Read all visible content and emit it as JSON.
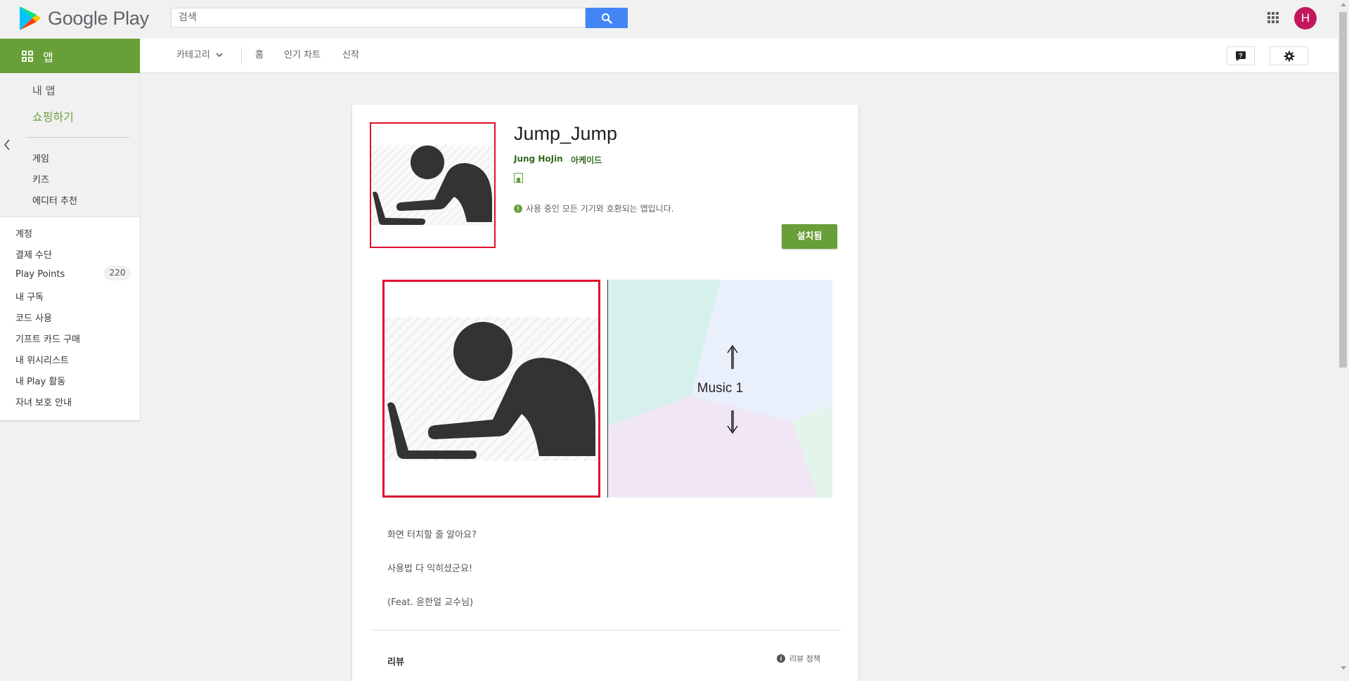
{
  "header": {
    "logo_text": "Google Play",
    "search_placeholder": "검색",
    "avatar_initial": "H",
    "icons": [
      "google-play-logo-icon",
      "search-icon",
      "apps-grid-icon",
      "help-icon",
      "gear-icon"
    ]
  },
  "subnav": {
    "category": "카테고리",
    "home": "홈",
    "top_charts": "인기 차트",
    "new_releases": "신작"
  },
  "apps_tab": {
    "label": "앱"
  },
  "sidebar": {
    "my_apps": "내 앱",
    "shop": "쇼핑하기",
    "categories": [
      "게임",
      "키즈",
      "에디터 추천"
    ],
    "account_links": [
      "계정",
      "결제 수단",
      "Play Points",
      "내 구독",
      "코드 사용",
      "기프트 카드 구매",
      "내 위시리스트",
      "내 Play 활동",
      "자녀 보호 안내"
    ],
    "play_points_count": "220"
  },
  "app": {
    "title": "Jump_Jump",
    "developer": "Jung HoJin",
    "category": "아케이드",
    "compatibility": "사용 중인 모든 기기와 호환되는 앱입니다.",
    "install_label": "설치됨",
    "screenshot2_label": "Music 1",
    "description": [
      "화면 터치할 줄 알아요?",
      "사용법 다 익히셨군요!",
      "(Feat. 윤한얼 교수님)"
    ],
    "reviews_title": "리뷰",
    "review_policy": "리뷰 정책"
  },
  "colors": {
    "brand_green": "#689f38",
    "dark_green_text": "#33691e",
    "search_blue": "#4285f4",
    "avatar": "#c2185b",
    "highlight_red": "#e0102d"
  }
}
